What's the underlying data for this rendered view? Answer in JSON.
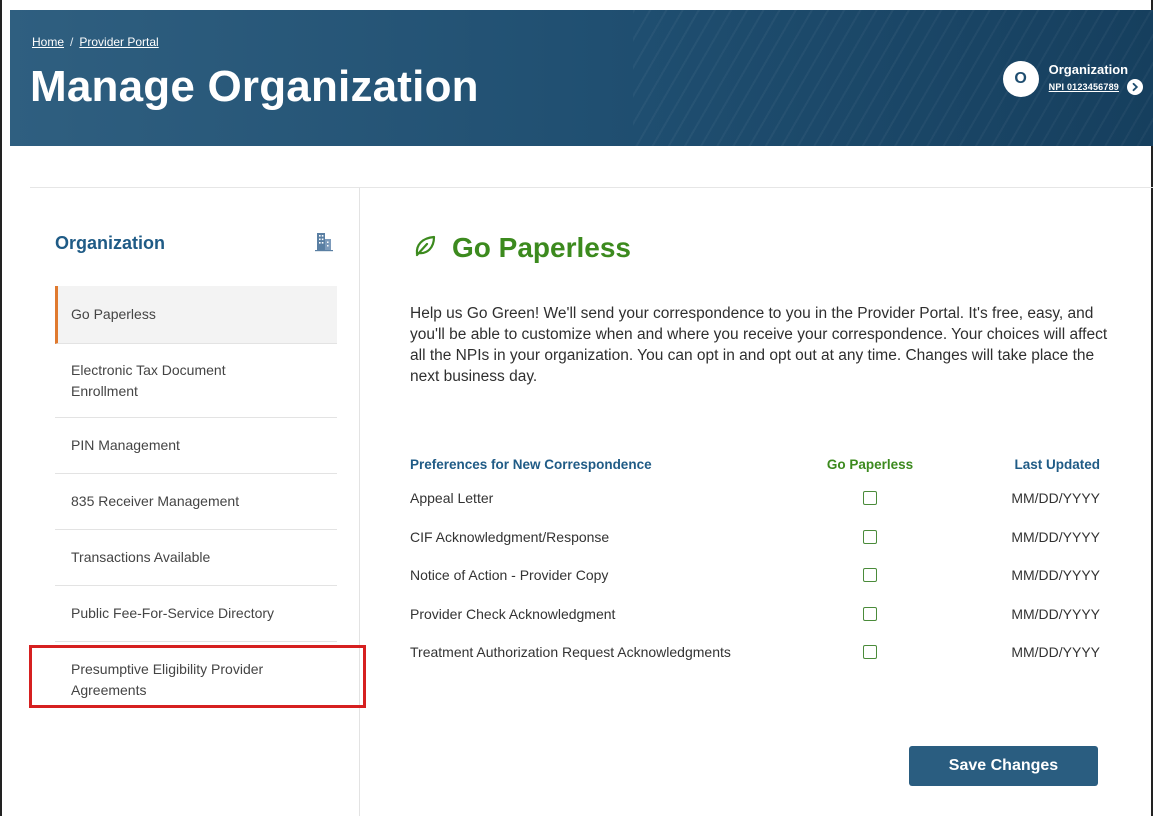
{
  "header": {
    "breadcrumb": [
      {
        "label": "Home"
      },
      {
        "label": "Provider Portal"
      }
    ],
    "breadcrumb_separator": "/",
    "title": "Manage Organization",
    "organization": {
      "avatar_initial": "O",
      "name": "Organization",
      "npi": "NPI 0123456789"
    }
  },
  "sidebar": {
    "title": "Organization",
    "title_icon": "building-icon",
    "items": [
      {
        "label": "Go Paperless",
        "active": true
      },
      {
        "label": "Electronic Tax Document Enrollment",
        "active": false
      },
      {
        "label": "PIN Management",
        "active": false
      },
      {
        "label": "835 Receiver Management",
        "active": false
      },
      {
        "label": "Transactions Available",
        "active": false
      },
      {
        "label": "Public Fee-For-Service Directory",
        "active": false
      },
      {
        "label": "Presumptive Eligibility Provider Agreements",
        "active": false
      }
    ]
  },
  "main": {
    "title": "Go Paperless",
    "title_icon": "leaf-icon",
    "intro": "Help us Go Green! We'll send your correspondence to you in the Provider Portal. It's free, easy, and you'll be able to customize when and where you receive your correspondence. Your choices will affect all the NPIs in your organization. You can opt in and opt out at any time. Changes will take place the next business day.",
    "table": {
      "headers": [
        "Preferences for New Correspondence",
        "Go Paperless",
        "Last Updated"
      ],
      "rows": [
        {
          "name": "Appeal Letter",
          "checked": false,
          "updated": "MM/DD/YYYY"
        },
        {
          "name": "CIF Acknowledgment/Response",
          "checked": false,
          "updated": "MM/DD/YYYY"
        },
        {
          "name": "Notice of Action - Provider Copy",
          "checked": false,
          "updated": "MM/DD/YYYY"
        },
        {
          "name": "Provider Check Acknowledgment",
          "checked": false,
          "updated": "MM/DD/YYYY"
        },
        {
          "name": "Treatment Authorization Request Acknowledgments",
          "checked": false,
          "updated": "MM/DD/YYYY"
        }
      ]
    },
    "save_label": "Save Changes"
  },
  "colors": {
    "header_bg": "#1f4e70",
    "accent_blue": "#1f5b86",
    "accent_green": "#3c8a1e",
    "active_marker": "#e07a2f",
    "highlight": "#d62020",
    "button": "#2a5d80"
  }
}
